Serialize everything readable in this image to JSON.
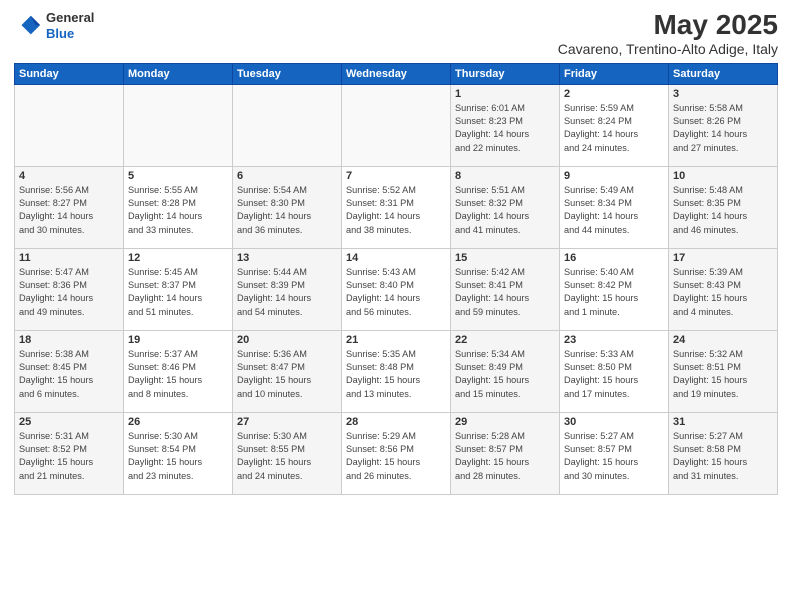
{
  "header": {
    "logo_general": "General",
    "logo_blue": "Blue",
    "title": "May 2025",
    "subtitle": "Cavareno, Trentino-Alto Adige, Italy"
  },
  "days_header": [
    "Sunday",
    "Monday",
    "Tuesday",
    "Wednesday",
    "Thursday",
    "Friday",
    "Saturday"
  ],
  "weeks": [
    [
      {
        "day": "",
        "info": ""
      },
      {
        "day": "",
        "info": ""
      },
      {
        "day": "",
        "info": ""
      },
      {
        "day": "",
        "info": ""
      },
      {
        "day": "1",
        "info": "Sunrise: 6:01 AM\nSunset: 8:23 PM\nDaylight: 14 hours\nand 22 minutes."
      },
      {
        "day": "2",
        "info": "Sunrise: 5:59 AM\nSunset: 8:24 PM\nDaylight: 14 hours\nand 24 minutes."
      },
      {
        "day": "3",
        "info": "Sunrise: 5:58 AM\nSunset: 8:26 PM\nDaylight: 14 hours\nand 27 minutes."
      }
    ],
    [
      {
        "day": "4",
        "info": "Sunrise: 5:56 AM\nSunset: 8:27 PM\nDaylight: 14 hours\nand 30 minutes."
      },
      {
        "day": "5",
        "info": "Sunrise: 5:55 AM\nSunset: 8:28 PM\nDaylight: 14 hours\nand 33 minutes."
      },
      {
        "day": "6",
        "info": "Sunrise: 5:54 AM\nSunset: 8:30 PM\nDaylight: 14 hours\nand 36 minutes."
      },
      {
        "day": "7",
        "info": "Sunrise: 5:52 AM\nSunset: 8:31 PM\nDaylight: 14 hours\nand 38 minutes."
      },
      {
        "day": "8",
        "info": "Sunrise: 5:51 AM\nSunset: 8:32 PM\nDaylight: 14 hours\nand 41 minutes."
      },
      {
        "day": "9",
        "info": "Sunrise: 5:49 AM\nSunset: 8:34 PM\nDaylight: 14 hours\nand 44 minutes."
      },
      {
        "day": "10",
        "info": "Sunrise: 5:48 AM\nSunset: 8:35 PM\nDaylight: 14 hours\nand 46 minutes."
      }
    ],
    [
      {
        "day": "11",
        "info": "Sunrise: 5:47 AM\nSunset: 8:36 PM\nDaylight: 14 hours\nand 49 minutes."
      },
      {
        "day": "12",
        "info": "Sunrise: 5:45 AM\nSunset: 8:37 PM\nDaylight: 14 hours\nand 51 minutes."
      },
      {
        "day": "13",
        "info": "Sunrise: 5:44 AM\nSunset: 8:39 PM\nDaylight: 14 hours\nand 54 minutes."
      },
      {
        "day": "14",
        "info": "Sunrise: 5:43 AM\nSunset: 8:40 PM\nDaylight: 14 hours\nand 56 minutes."
      },
      {
        "day": "15",
        "info": "Sunrise: 5:42 AM\nSunset: 8:41 PM\nDaylight: 14 hours\nand 59 minutes."
      },
      {
        "day": "16",
        "info": "Sunrise: 5:40 AM\nSunset: 8:42 PM\nDaylight: 15 hours\nand 1 minute."
      },
      {
        "day": "17",
        "info": "Sunrise: 5:39 AM\nSunset: 8:43 PM\nDaylight: 15 hours\nand 4 minutes."
      }
    ],
    [
      {
        "day": "18",
        "info": "Sunrise: 5:38 AM\nSunset: 8:45 PM\nDaylight: 15 hours\nand 6 minutes."
      },
      {
        "day": "19",
        "info": "Sunrise: 5:37 AM\nSunset: 8:46 PM\nDaylight: 15 hours\nand 8 minutes."
      },
      {
        "day": "20",
        "info": "Sunrise: 5:36 AM\nSunset: 8:47 PM\nDaylight: 15 hours\nand 10 minutes."
      },
      {
        "day": "21",
        "info": "Sunrise: 5:35 AM\nSunset: 8:48 PM\nDaylight: 15 hours\nand 13 minutes."
      },
      {
        "day": "22",
        "info": "Sunrise: 5:34 AM\nSunset: 8:49 PM\nDaylight: 15 hours\nand 15 minutes."
      },
      {
        "day": "23",
        "info": "Sunrise: 5:33 AM\nSunset: 8:50 PM\nDaylight: 15 hours\nand 17 minutes."
      },
      {
        "day": "24",
        "info": "Sunrise: 5:32 AM\nSunset: 8:51 PM\nDaylight: 15 hours\nand 19 minutes."
      }
    ],
    [
      {
        "day": "25",
        "info": "Sunrise: 5:31 AM\nSunset: 8:52 PM\nDaylight: 15 hours\nand 21 minutes."
      },
      {
        "day": "26",
        "info": "Sunrise: 5:30 AM\nSunset: 8:54 PM\nDaylight: 15 hours\nand 23 minutes."
      },
      {
        "day": "27",
        "info": "Sunrise: 5:30 AM\nSunset: 8:55 PM\nDaylight: 15 hours\nand 24 minutes."
      },
      {
        "day": "28",
        "info": "Sunrise: 5:29 AM\nSunset: 8:56 PM\nDaylight: 15 hours\nand 26 minutes."
      },
      {
        "day": "29",
        "info": "Sunrise: 5:28 AM\nSunset: 8:57 PM\nDaylight: 15 hours\nand 28 minutes."
      },
      {
        "day": "30",
        "info": "Sunrise: 5:27 AM\nSunset: 8:57 PM\nDaylight: 15 hours\nand 30 minutes."
      },
      {
        "day": "31",
        "info": "Sunrise: 5:27 AM\nSunset: 8:58 PM\nDaylight: 15 hours\nand 31 minutes."
      }
    ]
  ]
}
